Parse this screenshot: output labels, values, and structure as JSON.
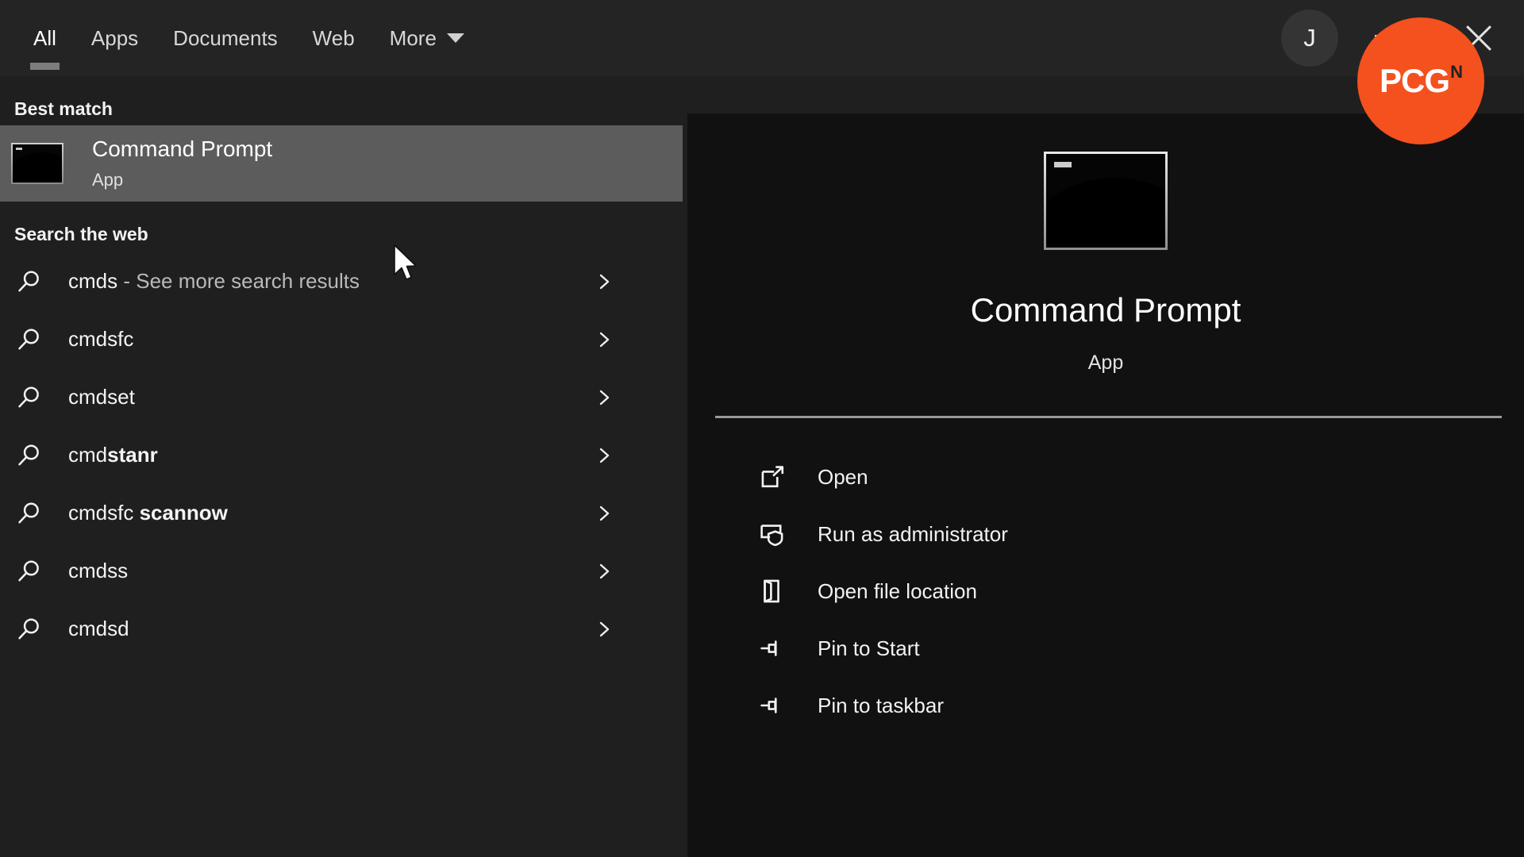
{
  "topbar": {
    "tabs": [
      {
        "label": "All",
        "active": true,
        "has_chevron": false
      },
      {
        "label": "Apps",
        "active": false,
        "has_chevron": false
      },
      {
        "label": "Documents",
        "active": false,
        "has_chevron": false
      },
      {
        "label": "Web",
        "active": false,
        "has_chevron": false
      },
      {
        "label": "More",
        "active": false,
        "has_chevron": true
      }
    ],
    "avatar_initial": "J",
    "more_options_icon": "ellipsis-icon",
    "close_icon": "close-icon"
  },
  "results": {
    "best_match_header": "Best match",
    "best_match": {
      "title": "Command Prompt",
      "subtitle": "App",
      "icon": "command-prompt-icon"
    },
    "search_web_header": "Search the web",
    "web_items": [
      {
        "prefix": "cmds",
        "suffix": " - See more search results",
        "bold_tail": ""
      },
      {
        "prefix": "cmdsfc",
        "suffix": "",
        "bold_tail": ""
      },
      {
        "prefix": "cmdset",
        "suffix": "",
        "bold_tail": ""
      },
      {
        "prefix": "cmd",
        "suffix": "",
        "bold_tail": "stanr"
      },
      {
        "prefix": "cmdsfc ",
        "suffix": "",
        "bold_tail": "scannow"
      },
      {
        "prefix": "cmdss",
        "suffix": "",
        "bold_tail": ""
      },
      {
        "prefix": "cmdsd",
        "suffix": "",
        "bold_tail": ""
      }
    ],
    "row_chevron_icon": "chevron-right-icon",
    "search_icon": "search-icon"
  },
  "detail": {
    "app_icon": "command-prompt-icon",
    "title": "Command Prompt",
    "subtitle": "App",
    "actions": [
      {
        "label": "Open",
        "icon": "open-external-icon"
      },
      {
        "label": "Run as administrator",
        "icon": "shield-admin-icon"
      },
      {
        "label": "Open file location",
        "icon": "folder-open-icon"
      },
      {
        "label": "Pin to Start",
        "icon": "pin-icon"
      },
      {
        "label": "Pin to taskbar",
        "icon": "pin-icon"
      }
    ]
  },
  "watermark": {
    "main": "PCG",
    "sup": "N",
    "color": "#f4511e"
  },
  "colors": {
    "topbar_bg": "#242424",
    "left_bg": "#1f1f1f",
    "right_bg": "#111111",
    "highlight_bg": "#5c5c5c",
    "tab_underline": "#7d7d7d",
    "divider": "#9a9a9a"
  }
}
